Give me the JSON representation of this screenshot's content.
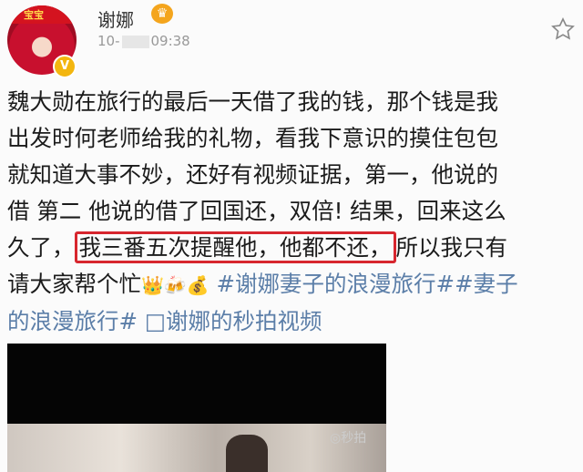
{
  "post": {
    "author": "谢娜",
    "time_prefix": "10-",
    "time_suffix": "09:38",
    "avatar_banner_text": "宝宝",
    "verified_badge": "V",
    "line1": "魏大勋在旅行的最后一天借了我的钱，那个钱是我",
    "line2": "出发时何老师给我的礼物，看我下意识的摸住包包",
    "line3": "就知道大事不妙，还好有视频证据，第一，他说的",
    "line4": "借 第二 他说的借了回国还，双倍! 结果，回来这么",
    "line5_pre": "久了，",
    "line5_highlight": "我三番五次提醒他，他都不还，",
    "line5_post": "所以我只有",
    "line6_pre": "请大家帮个忙",
    "line6_emoji": "👑🍻💰",
    "tag1": "#谢娜妻子的浪漫旅行##妻子",
    "tag2": "的浪漫旅行#",
    "video_link": "□谢娜的秒拍视频",
    "watermark": "◎秒拍"
  },
  "colors": {
    "link": "#5b7ea8",
    "highlight_border": "#d7262e"
  },
  "icons": [
    "star-icon",
    "crown-icon",
    "verified-icon",
    "video-icon"
  ]
}
